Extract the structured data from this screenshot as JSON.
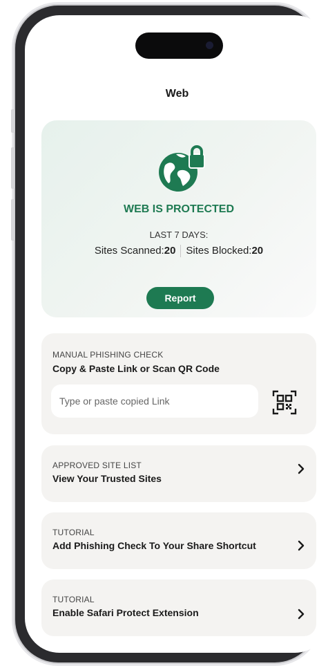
{
  "header": {
    "title": "Web"
  },
  "status": {
    "headline": "WEB IS PROTECTED",
    "period_label": "LAST 7 DAYS:",
    "sites_scanned_label": "Sites Scanned:",
    "sites_scanned_value": "20",
    "sites_blocked_label": "Sites Blocked:",
    "sites_blocked_value": "20",
    "report_button": "Report",
    "icon": "globe-lock-icon"
  },
  "manual_check": {
    "overline": "MANUAL PHISHING CHECK",
    "heading": "Copy & Paste Link or Scan QR Code",
    "input_placeholder": "Type or paste copied Link",
    "input_value": "",
    "qr_icon": "qr-code-icon"
  },
  "cards": [
    {
      "overline": "APPROVED SITE LIST",
      "heading": "View Your Trusted Sites"
    },
    {
      "overline": "TUTORIAL",
      "heading": "Add Phishing Check To Your Share Shortcut"
    },
    {
      "overline": "TUTORIAL",
      "heading": "Enable Safari Protect Extension"
    }
  ],
  "colors": {
    "accent": "#1e7a52",
    "card_background": "#f4f3f1",
    "hero_tint": "#e6f1ec"
  }
}
